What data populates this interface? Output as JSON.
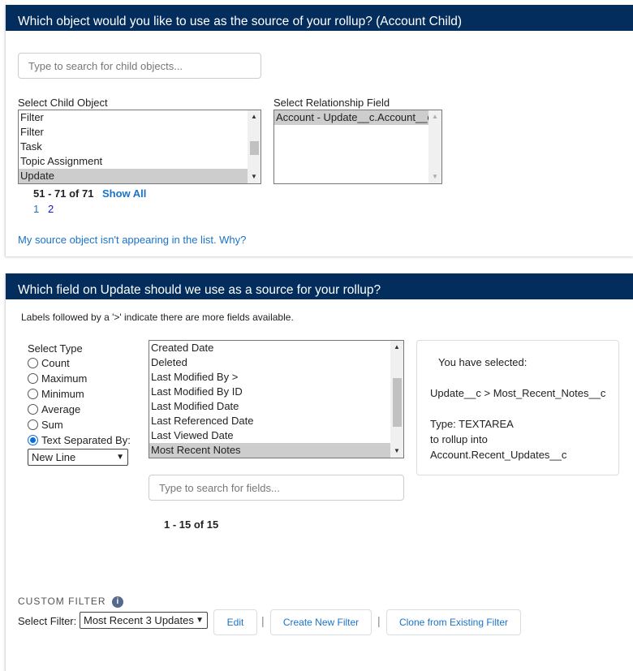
{
  "section1": {
    "title": "Which object would you like to use as the source of your rollup? (Account Child)",
    "search_placeholder": "Type to search for child objects...",
    "child_label": "Select Child Object",
    "child_options": [
      "Filter",
      "Filter",
      "Task",
      "Topic Assignment",
      "Update"
    ],
    "child_selected": "Update",
    "rel_label": "Select Relationship Field",
    "rel_options": [
      "Account - Update__c.Account__c"
    ],
    "pagination": "51 - 71 of 71",
    "show_all": "Show All",
    "pages": [
      "1",
      "2"
    ],
    "help_link": "My source object isn't appearing in the list. Why?"
  },
  "section2": {
    "title": "Which field on Update should we use as a source for your rollup?",
    "hint": "Labels followed by a '>' indicate there are more fields available.",
    "type_label": "Select Type",
    "types": [
      "Count",
      "Maximum",
      "Minimum",
      "Average",
      "Sum",
      "Text Separated By:"
    ],
    "selected_type": "Text Separated By:",
    "separator": "New Line",
    "fields": [
      "Created Date",
      "Deleted",
      "Last Modified By >",
      "Last Modified By ID",
      "Last Modified Date",
      "Last Referenced Date",
      "Last Viewed Date",
      "Most Recent Notes"
    ],
    "selected_field": "Most Recent Notes",
    "field_search_placeholder": "Type to search for fields...",
    "field_pagination": "1 - 15 of 15",
    "summary": {
      "heading": "You have selected:",
      "path": "Update__c > Most_Recent_Notes__c",
      "type": "Type: TEXTAREA",
      "rollup_into": "to rollup into",
      "target": "Account.Recent_Updates__c"
    },
    "custom_filter": {
      "heading": "CUSTOM FILTER",
      "select_label": "Select Filter:",
      "selected": "Most Recent 3 Updates",
      "edit": "Edit",
      "create": "Create New Filter",
      "clone": "Clone from Existing Filter"
    }
  },
  "colors": {
    "header": "#032d5c",
    "link": "#1a73c9"
  }
}
